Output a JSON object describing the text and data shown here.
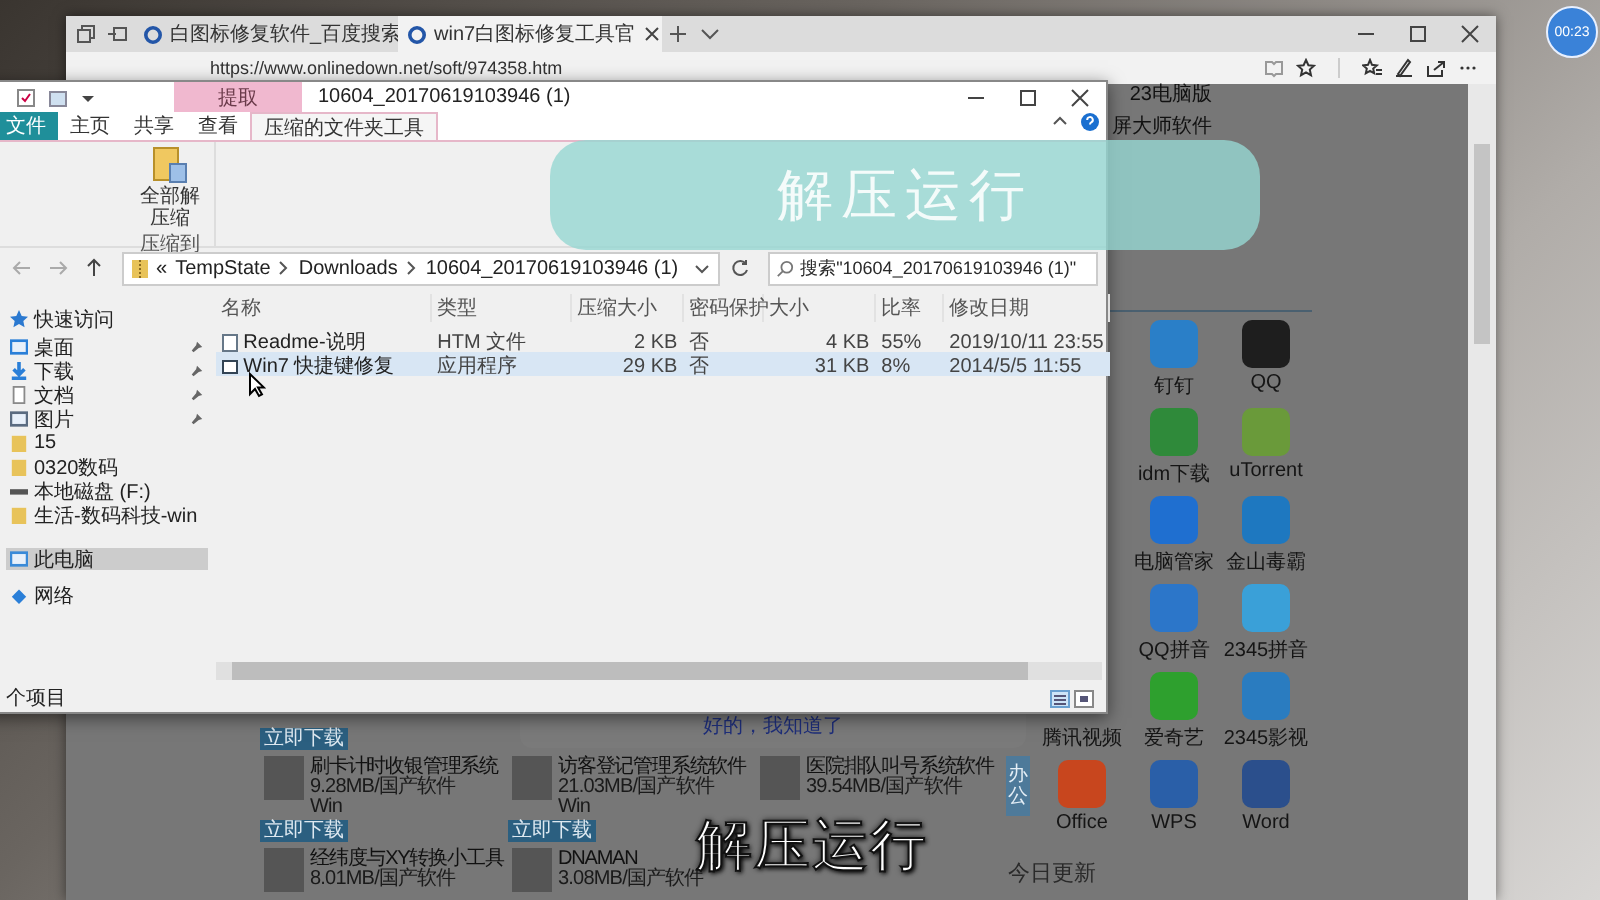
{
  "timer": "00:23",
  "browser": {
    "tabs": [
      {
        "title": "白图标修复软件_百度搜索",
        "selected": false
      },
      {
        "title": "win7白图标修复工具官",
        "selected": true
      }
    ],
    "url": "https://www.onlinedown.net/soft/974358.htm",
    "aside_texts": [
      "23电脑版",
      "屏大师软件"
    ],
    "app_rows": [
      [
        {
          "name": "钉钉",
          "color": "#2a7fc8"
        },
        {
          "name": "QQ",
          "color": "#1e1e1e"
        }
      ],
      [
        {
          "name": "idm下载",
          "color": "#2f8a3a"
        },
        {
          "name": "uTorrent",
          "color": "#6a9a3a"
        }
      ],
      [
        {
          "name": "电脑管家",
          "color": "#1f6fd0"
        },
        {
          "name": "金山毒霸",
          "color": "#1e78c0"
        }
      ],
      [
        {
          "name": "QQ拼音",
          "color": "#2c76c9"
        },
        {
          "name": "2345拼音",
          "color": "#3aa0d8"
        }
      ],
      [
        {
          "name": "腾讯视频"
        },
        {
          "name": "爱奇艺",
          "color": "#2ea02e"
        },
        {
          "name": "2345影视",
          "color": "#2a7cc0"
        }
      ],
      [
        {
          "name": "Office",
          "color": "#c8461e"
        },
        {
          "name": "WPS",
          "color": "#2a5fa8"
        },
        {
          "name": "Word",
          "color": "#2b4f8c"
        }
      ]
    ],
    "side_tab": "办公",
    "today_heading": "今日更新",
    "software_rows": [
      [
        {
          "download": "立即下载"
        }
      ],
      [
        {
          "title": "刷卡计时收银管理系统",
          "meta": "9.28MB/国产软件",
          "platform": "Win",
          "download": "立即下载"
        },
        {
          "title": "访客登记管理系统软件",
          "meta": "21.03MB/国产软件",
          "platform": "Win",
          "download": "立即下载"
        },
        {
          "title": "医院排队叫号系统软件",
          "meta": "39.54MB/国产软件"
        }
      ],
      [
        {
          "title": "经纬度与XY转换小工具",
          "meta": "8.01MB/国产软件"
        },
        {
          "title": "DNAMAN",
          "meta": "3.08MB/国产软件"
        }
      ]
    ]
  },
  "explorer": {
    "title": "10604_20170619103946 (1)",
    "context_tab": "提取",
    "ribbon_tabs": [
      {
        "label": "文件",
        "kind": "file",
        "selected": false
      },
      {
        "label": "主页",
        "kind": "tab",
        "selected": false
      },
      {
        "label": "共享",
        "kind": "tab",
        "selected": false
      },
      {
        "label": "查看",
        "kind": "tab",
        "selected": false
      },
      {
        "label": "压缩的文件夹工具",
        "kind": "tab",
        "selected": true
      }
    ],
    "ribbon_button": "全部解压缩",
    "ribbon_group": "压缩到",
    "breadcrumb_lead": "«",
    "breadcrumb": [
      "TempState",
      "Downloads",
      "10604_20170619103946 (1)"
    ],
    "search": {
      "placeholder": "搜索\"10604_20170619103946 (1)\""
    },
    "nav": [
      {
        "label": "快速访问",
        "kind": "star",
        "pinned": false,
        "selected": false
      },
      {
        "label": "桌面",
        "kind": "desktop",
        "pinned": true,
        "selected": false
      },
      {
        "label": "下载",
        "kind": "download",
        "pinned": true,
        "selected": false
      },
      {
        "label": "文档",
        "kind": "document",
        "pinned": true,
        "selected": false
      },
      {
        "label": "图片",
        "kind": "picture",
        "pinned": true,
        "selected": false
      },
      {
        "label": "15",
        "kind": "folder",
        "pinned": false,
        "selected": false
      },
      {
        "label": "0320数码",
        "kind": "folder",
        "pinned": false,
        "selected": false
      },
      {
        "label": "本地磁盘 (F:)",
        "kind": "drive",
        "pinned": false,
        "selected": false
      },
      {
        "label": "生活-数码科技-win",
        "kind": "folder",
        "pinned": false,
        "selected": false
      },
      {
        "label": "此电脑",
        "kind": "pc",
        "pinned": false,
        "selected": true
      },
      {
        "label": "网络",
        "kind": "network",
        "pinned": false,
        "selected": false
      }
    ],
    "columns": [
      "名称",
      "类型",
      "压缩大小",
      "密码保护",
      "大小",
      "比率",
      "修改日期"
    ],
    "files": [
      {
        "kind": "htm",
        "selected": false,
        "cells": [
          "Readme-说明",
          "HTM 文件",
          "2 KB",
          "否",
          "4 KB",
          "55%",
          "2019/10/11 23:55"
        ]
      },
      {
        "kind": "exe",
        "selected": true,
        "cells": [
          "Win7 快捷键修复",
          "应用程序",
          "29 KB",
          "否",
          "31 KB",
          "8%",
          "2014/5/5 11:55"
        ]
      }
    ],
    "status": "个项目"
  },
  "dialog": {
    "button": "好的，我知道了"
  },
  "overlay_caption": "解压运行",
  "subtitle": "解压运行"
}
